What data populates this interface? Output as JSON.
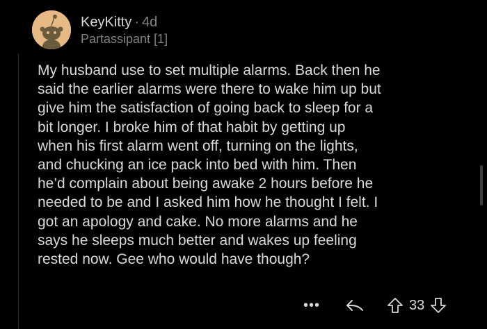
{
  "comment": {
    "username": "KeyKitty",
    "separator": "·",
    "age": "4d",
    "flair": "Partassipant [1]",
    "body_lines": [
      "My husband use to set multiple alarms. Back then he",
      "said the earlier alarms were there to wake him up but",
      "give him the satisfaction of going back to sleep for a",
      "bit longer. I broke him of that habit by getting up",
      "when his first alarm went off, turning on the lights,",
      "and chucking an ice pack into bed with him. Then",
      "he’d complain about being awake 2 hours before he",
      "needed to be and I asked him how he thought I felt. I",
      "got an apology and cake. No more alarms and he",
      "says he sleeps much better and wakes up feeling",
      "rested now. Gee who would have though?"
    ]
  },
  "actions": {
    "more_label": "•••",
    "score": "33",
    "icons": [
      "more-icon",
      "reply-icon",
      "upvote-icon",
      "downvote-icon"
    ]
  },
  "colors": {
    "background": "#000000",
    "text": "#d7dadc",
    "meta": "#818384",
    "avatar_bg": "#e7b984"
  }
}
